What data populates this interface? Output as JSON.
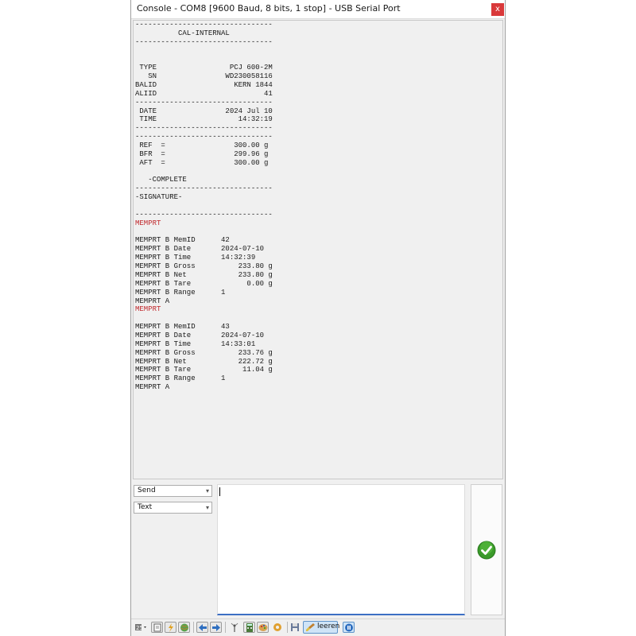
{
  "window": {
    "title": "Console - COM8 [9600 Baud, 8 bits, 1 stop] - USB Serial Port",
    "close_label": "x"
  },
  "output": {
    "lines_before_red1": "--------------------------------\n          CAL-INTERNAL\n--------------------------------\n\n\n TYPE                 PCJ 600-2M\n   SN                WD230058116\nBALID                  KERN 1844\nALIID                         41\n--------------------------------\n DATE                2024 Jul 10\n TIME                   14:32:19\n--------------------------------\n--------------------------------\n REF  =                300.00 g\n BFR  =                299.96 g\n AFT  =                300.00 g\n\n   -COMPLETE\n--------------------------------\n-SIGNATURE-\n\n--------------------------------",
    "red1": "MEMPRT",
    "lines_between": "\nMEMPRT B MemID      42\nMEMPRT B Date       2024-07-10\nMEMPRT B Time       14:32:39\nMEMPRT B Gross          233.80 g\nMEMPRT B Net            233.80 g\nMEMPRT B Tare             0.00 g\nMEMPRT B Range      1\nMEMPRT A",
    "red2": "MEMPRT",
    "lines_after": "\nMEMPRT B MemID      43\nMEMPRT B Date       2024-07-10\nMEMPRT B Time       14:33:01\nMEMPRT B Gross          233.76 g\nMEMPRT B Net            222.72 g\nMEMPRT B Tare            11.04 g\nMEMPRT B Range      1\nMEMPRT A"
  },
  "send_panel": {
    "mode_select": "Send",
    "format_select": "Text",
    "input_value": ""
  },
  "toolbar": {
    "icons": [
      "settings-dropdown-icon",
      "file-icon",
      "flash-icon",
      "globe-icon",
      "arrow-left-icon",
      "arrow-right-icon",
      "antenna-icon",
      "calculator-icon",
      "palette-icon",
      "gear-icon",
      "save-icon",
      "pause-icon"
    ],
    "clear_label": "leeren"
  },
  "colors": {
    "highlight_red": "#c0282c",
    "send_check_green": "#3a9a2a",
    "input_focus_blue": "#3c6fc4"
  }
}
